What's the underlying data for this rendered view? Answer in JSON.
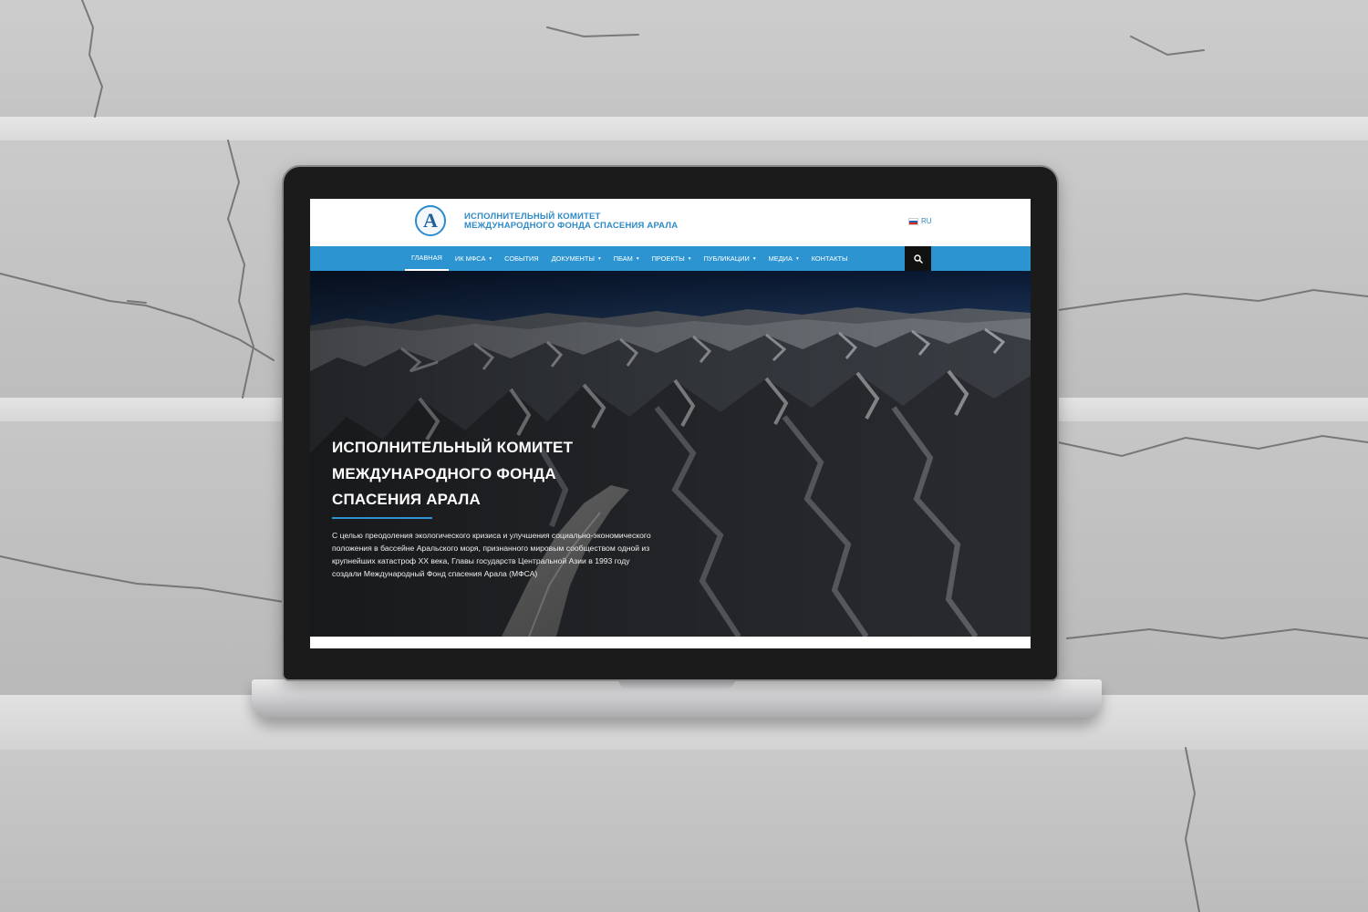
{
  "header": {
    "logo_letter": "A",
    "site_title_line1": "ИСПОЛНИТЕЛЬНЫЙ КОМИТЕТ",
    "site_title_line2": "МЕЖДУНАРОДНОГО ФОНДА СПАСЕНИЯ АРАЛА",
    "language": "RU"
  },
  "nav": {
    "items": [
      {
        "label": "ГЛАВНАЯ",
        "active": true,
        "dropdown": false
      },
      {
        "label": "ИК МФСА",
        "active": false,
        "dropdown": true
      },
      {
        "label": "СОБЫТИЯ",
        "active": false,
        "dropdown": false
      },
      {
        "label": "ДОКУМЕНТЫ",
        "active": false,
        "dropdown": true
      },
      {
        "label": "ПБАМ",
        "active": false,
        "dropdown": true
      },
      {
        "label": "ПРОЕКТЫ",
        "active": false,
        "dropdown": true
      },
      {
        "label": "ПУБЛИКАЦИИ",
        "active": false,
        "dropdown": true
      },
      {
        "label": "МЕДИА",
        "active": false,
        "dropdown": true
      },
      {
        "label": "КОНТАКТЫ",
        "active": false,
        "dropdown": false
      }
    ],
    "caret_icon": "▾",
    "search_icon": "search-icon"
  },
  "hero": {
    "title_line1": "ИСПОЛНИТЕЛЬНЫЙ КОМИТЕТ",
    "title_line2": "МЕЖДУНАРОДНОГО ФОНДА",
    "title_line3": "СПАСЕНИЯ АРАЛА",
    "text": "С целью преодоления экологического кризиса и улучшения социально-экономического положения в бассейне Аральского моря, признанного мировым сообществом одной из крупнейших катастроф XX века, Главы государств Центральной Азии в 1993 году создали Международный Фонд спасения Арала (МФСА)"
  },
  "colors": {
    "accent": "#2c95d1",
    "title_blue": "#2f8ac6",
    "search_bg": "#111111"
  }
}
